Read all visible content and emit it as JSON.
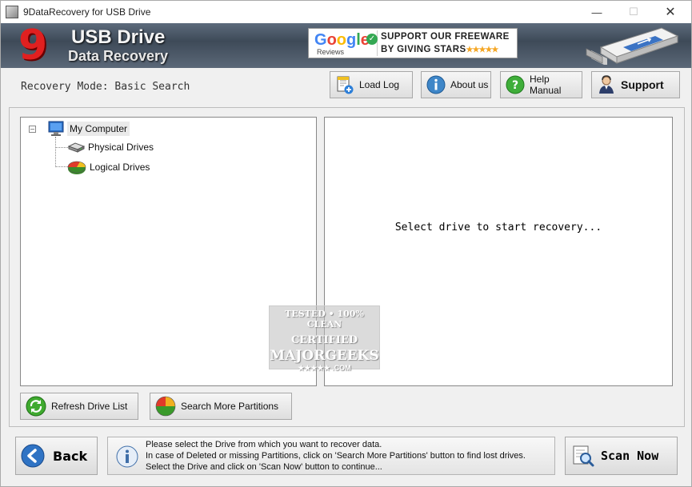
{
  "window": {
    "title": "9DataRecovery for USB Drive"
  },
  "banner": {
    "logo_mark": "9",
    "logo_line1": "USB Drive",
    "logo_line2": "Data Recovery",
    "promo": {
      "google": "Google",
      "reviews": "Reviews",
      "line1": "SUPPORT OUR FREEWARE",
      "line2": "BY GIVING STARS",
      "stars": "★★★★★"
    }
  },
  "mode": {
    "label": "Recovery Mode: Basic Search"
  },
  "toolbar": {
    "load_log": "Load Log",
    "about": "About us",
    "help": "Help Manual",
    "support": "Support"
  },
  "tree": {
    "root": "My Computer",
    "children": [
      "Physical Drives",
      "Logical Drives"
    ]
  },
  "info": {
    "message": "Select drive to start recovery..."
  },
  "watermark": {
    "line1": "TESTED • 100% CLEAN",
    "line2": "CERTIFIED",
    "line3": "MAJORGEEKS",
    "line4": "★★★★★ .COM"
  },
  "panel_buttons": {
    "refresh": "Refresh Drive List",
    "search_partitions": "Search More Partitions"
  },
  "footer": {
    "back": "Back",
    "hint_lines": [
      "Please select the Drive from which you want to recover data.",
      "In case of Deleted or missing Partitions, click on 'Search More Partitions' button to find lost drives.",
      "Select the Drive and click on 'Scan Now' button to continue..."
    ],
    "scan": "Scan Now"
  },
  "colors": {
    "accent_red": "#e02020",
    "banner_dark": "#3e4a58",
    "button_border": "#a8a8a8"
  }
}
